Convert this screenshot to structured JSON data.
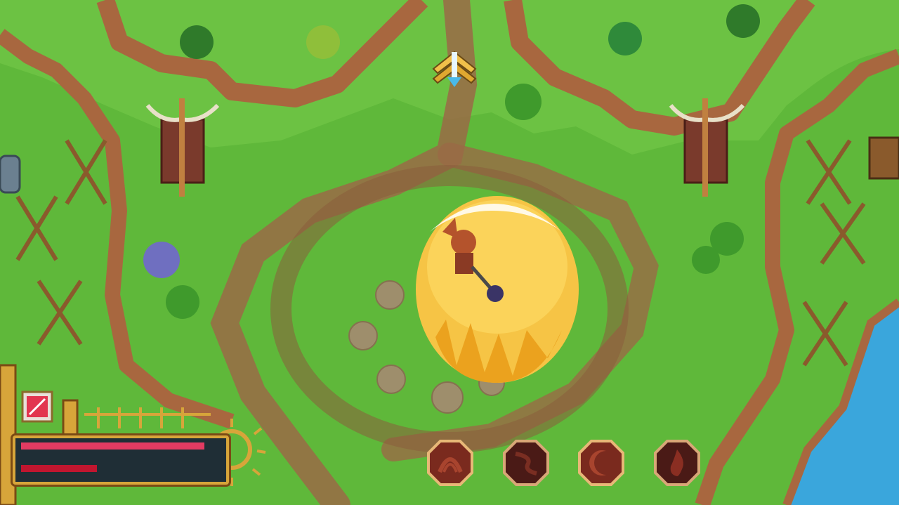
{
  "scene": {
    "description_free": true,
    "colors": {
      "grass": "#5fb83a",
      "grass_dark": "#3f9a2c",
      "path": "#9a6a46",
      "cliff": "#a8673f",
      "water": "#3aa6dc",
      "shield": "#f6c445",
      "hud_gold": "#d7a53a"
    }
  },
  "quest_marker": {
    "icon": "direction-arrow-icon"
  },
  "hud": {
    "item_slot": {
      "icon": "item-slot-icon"
    },
    "health": {
      "fraction": 0.92,
      "color": "#e23b62"
    },
    "mana": {
      "fraction": 0.0,
      "color": "#3a5d6e"
    },
    "stamina": {
      "fraction": 0.38,
      "color": "#c0162f"
    }
  },
  "skills": [
    {
      "name": "skill-1",
      "icon": "arch-rune-icon"
    },
    {
      "name": "skill-2",
      "icon": "dragon-rune-icon"
    },
    {
      "name": "skill-3",
      "icon": "moon-rune-icon"
    },
    {
      "name": "skill-4",
      "icon": "flame-rune-icon"
    }
  ]
}
